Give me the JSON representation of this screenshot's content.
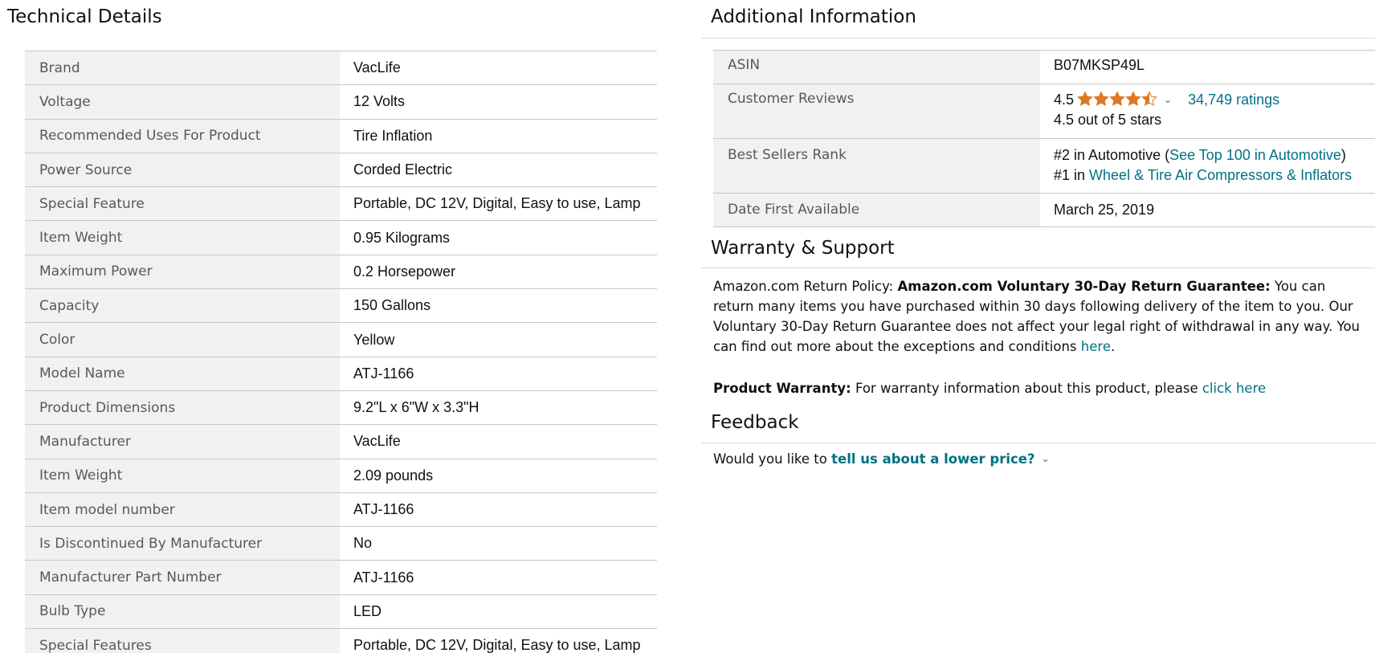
{
  "technical_details": {
    "title": "Technical Details",
    "rows": [
      {
        "key": "Brand",
        "value": "VacLife"
      },
      {
        "key": "Voltage",
        "value": "12 Volts"
      },
      {
        "key": "Recommended Uses For Product",
        "value": "Tire Inflation"
      },
      {
        "key": "Power Source",
        "value": "Corded Electric"
      },
      {
        "key": "Special Feature",
        "value": "Portable, DC 12V, Digital, Easy to use, Lamp"
      },
      {
        "key": "Item Weight",
        "value": "0.95 Kilograms"
      },
      {
        "key": "Maximum Power",
        "value": "0.2 Horsepower"
      },
      {
        "key": "Capacity",
        "value": "150 Gallons"
      },
      {
        "key": "Color",
        "value": "Yellow"
      },
      {
        "key": "Model Name",
        "value": "ATJ-1166"
      },
      {
        "key": "Product Dimensions",
        "value": "9.2\"L x 6\"W x 3.3\"H"
      },
      {
        "key": "Manufacturer",
        "value": "VacLife"
      },
      {
        "key": "Item Weight",
        "value": "2.09 pounds"
      },
      {
        "key": "Item model number",
        "value": "ATJ-1166"
      },
      {
        "key": "Is Discontinued By Manufacturer",
        "value": "No"
      },
      {
        "key": "Manufacturer Part Number",
        "value": "ATJ-1166"
      },
      {
        "key": "Bulb Type",
        "value": "LED"
      },
      {
        "key": "Special Features",
        "value": "Portable, DC 12V, Digital, Easy to use, Lamp"
      }
    ]
  },
  "additional_info": {
    "title": "Additional Information",
    "asin": {
      "key": "ASIN",
      "value": "B07MKSP49L"
    },
    "reviews": {
      "key": "Customer Reviews",
      "rating": "4.5",
      "rating_value": 4.5,
      "ratings_link": "34,749 ratings",
      "summary": "4.5 out of 5 stars",
      "star_color": "#de7921",
      "icon": "chevron-down-icon"
    },
    "rank": {
      "key": "Best Sellers Rank",
      "line1_prefix": "#2 in Automotive (",
      "line1_link": "See Top 100 in Automotive",
      "line1_suffix": ")",
      "line2_prefix": "#1 in ",
      "line2_link": "Wheel & Tire Air Compressors & Inflators"
    },
    "date": {
      "key": "Date First Available",
      "value": "March 25, 2019"
    }
  },
  "warranty": {
    "title": "Warranty & Support",
    "policy_label": "Amazon.com Return Policy:",
    "policy_bold": "Amazon.com Voluntary 30-Day Return Guarantee:",
    "policy_text": "You can return many items you have purchased within 30 days following delivery of the item to you. Our Voluntary 30-Day Return Guarantee does not affect your legal right of withdrawal in any way. You can find out more about the exceptions and conditions",
    "policy_link": "here",
    "product_label": "Product Warranty:",
    "product_text": "For warranty information about this product, please",
    "product_link": "click here"
  },
  "feedback": {
    "title": "Feedback",
    "prompt": "Would you like to",
    "link": "tell us about a lower price?"
  },
  "colors": {
    "link": "#007185",
    "key_cell_bg": "#f0f2f2",
    "star": "#de7921"
  }
}
